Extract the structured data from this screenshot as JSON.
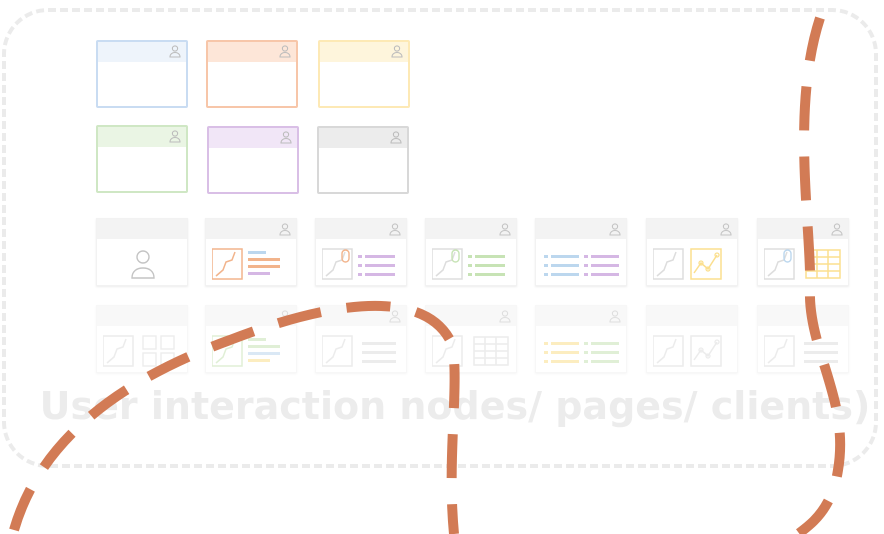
{
  "caption": "User interaction nodes/ pages/ clients)",
  "colors": {
    "container_border": "#ebebeb",
    "dashed_path": "#d27b55",
    "caption": "#ececec",
    "window_palette": [
      "#c9dcf2",
      "#f7c6a9",
      "#fde9b5",
      "#cfe7c4",
      "#d9bfe6",
      "#cfcfcf"
    ],
    "card_accents": {
      "orange": "#f2b48c",
      "purple": "#d5b7e4",
      "green": "#c7e3b5",
      "blue": "#bcd7ee",
      "yellow": "#fbdf8e",
      "gray": "#dddddd"
    }
  },
  "icons": {
    "user": "person-icon",
    "image": "image-icon",
    "list": "list-icon",
    "chart": "line-chart-icon",
    "table": "table-icon",
    "grid": "grid-icon",
    "touch": "touch-icon"
  }
}
